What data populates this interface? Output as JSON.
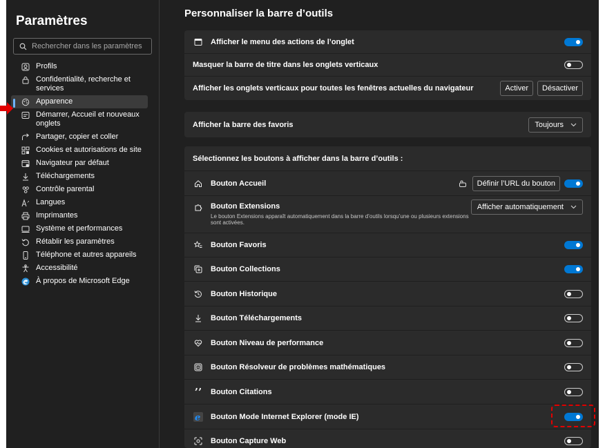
{
  "sidebar": {
    "title": "Paramètres",
    "search_placeholder": "Rechercher dans les paramètres",
    "items": [
      {
        "label": "Profils",
        "icon": "profile-icon"
      },
      {
        "label": "Confidentialité, recherche et services",
        "icon": "lock-icon"
      },
      {
        "label": "Apparence",
        "icon": "appearance-icon",
        "active": true
      },
      {
        "label": "Démarrer, Accueil et nouveaux onglets",
        "icon": "start-icon"
      },
      {
        "label": "Partager, copier et coller",
        "icon": "share-icon"
      },
      {
        "label": "Cookies et autorisations de site",
        "icon": "cookies-icon"
      },
      {
        "label": "Navigateur par défaut",
        "icon": "default-browser-icon"
      },
      {
        "label": "Téléchargements",
        "icon": "download-icon"
      },
      {
        "label": "Contrôle parental",
        "icon": "family-icon"
      },
      {
        "label": "Langues",
        "icon": "language-icon"
      },
      {
        "label": "Imprimantes",
        "icon": "printer-icon"
      },
      {
        "label": "Système et performances",
        "icon": "system-icon"
      },
      {
        "label": "Rétablir les paramètres",
        "icon": "reset-icon"
      },
      {
        "label": "Téléphone et autres appareils",
        "icon": "phone-icon"
      },
      {
        "label": "Accessibilité",
        "icon": "accessibility-icon"
      },
      {
        "label": "À propos de Microsoft Edge",
        "icon": "edge-logo-icon"
      }
    ]
  },
  "main": {
    "title": "Personnaliser la barre d’outils",
    "tab_actions": {
      "label": "Afficher le menu des actions de l’onglet",
      "on": true
    },
    "hide_title_bar": {
      "label": "Masquer la barre de titre dans les onglets verticaux",
      "on": false
    },
    "vertical_tabs": {
      "label": "Afficher les onglets verticaux pour toutes les fenêtres actuelles du navigateur",
      "activate": "Activer",
      "deactivate": "Désactiver"
    },
    "favorites_bar": {
      "label": "Afficher la barre des favoris",
      "value": "Toujours"
    },
    "buttons_section": "Sélectionnez les boutons à afficher dans la barre d’outils :",
    "home": {
      "label": "Bouton Accueil",
      "set_url": "Définir l’URL du bouton",
      "on": true
    },
    "extensions": {
      "label": "Bouton Extensions",
      "value": "Afficher automatiquement",
      "desc": "Le bouton Extensions apparaît automatiquement dans la barre d’outils lorsqu’une ou plusieurs extensions sont activées."
    },
    "favorites": {
      "label": "Bouton Favoris",
      "on": true
    },
    "collections": {
      "label": "Bouton Collections",
      "on": true
    },
    "history": {
      "label": "Bouton Historique",
      "on": false
    },
    "downloads": {
      "label": "Bouton Téléchargements",
      "on": false
    },
    "performance": {
      "label": "Bouton Niveau de performance",
      "on": false
    },
    "math": {
      "label": "Bouton Résolveur de problèmes mathématiques",
      "on": false
    },
    "citations": {
      "label": "Bouton Citations",
      "on": false
    },
    "ie_mode": {
      "label": "Bouton Mode Internet Explorer (mode IE)",
      "on": true
    },
    "web_capture": {
      "label": "Bouton Capture Web",
      "on": false
    }
  },
  "colors": {
    "accent": "#0078d4",
    "annotation": "#e30000",
    "background": "#202020",
    "card": "#2b2b2b"
  }
}
